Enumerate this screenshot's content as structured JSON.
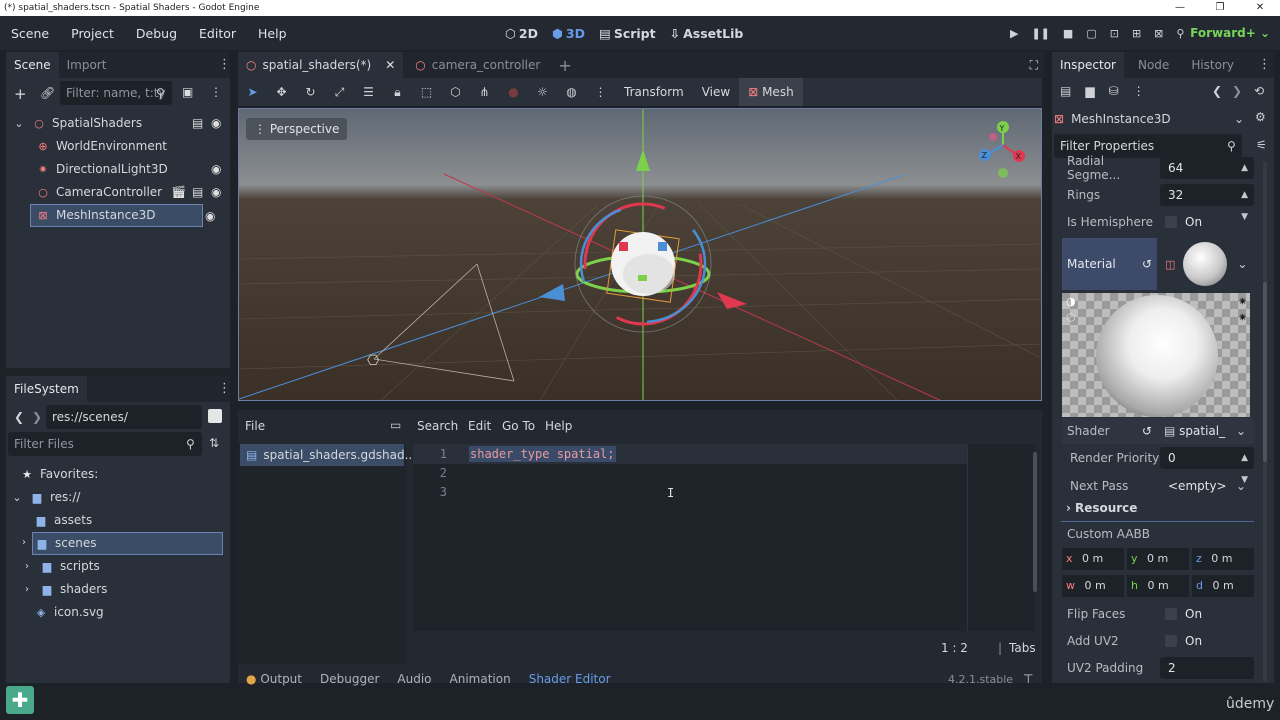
{
  "window": {
    "title": "(*) spatial_shaders.tscn - Spatial Shaders - Godot Engine",
    "controls": [
      "—",
      "❐",
      "✕"
    ]
  },
  "menubar": {
    "items": [
      "Scene",
      "Project",
      "Debug",
      "Editor",
      "Help"
    ],
    "modes": [
      "2D",
      "3D",
      "Script",
      "AssetLib"
    ],
    "renderer": "Forward+"
  },
  "scene_dock": {
    "tabs": [
      "Scene",
      "Import"
    ],
    "filter_placeholder": "Filter: name, t:ty",
    "nodes": [
      "SpatialShaders",
      "WorldEnvironment",
      "DirectionalLight3D",
      "CameraController",
      "MeshInstance3D"
    ]
  },
  "filesystem_dock": {
    "tab": "FileSystem",
    "path": "res://scenes/",
    "filter_placeholder": "Filter Files",
    "items": [
      "Favorites:",
      "res://",
      "assets",
      "scenes",
      "scripts",
      "shaders",
      "icon.svg"
    ]
  },
  "editor_tabs": [
    "spatial_shaders(*)",
    "camera_controller"
  ],
  "viewport_toolbar": {
    "menus": [
      "Transform",
      "View",
      "Mesh"
    ],
    "perspective_label": "Perspective"
  },
  "gizmo_axes": [
    "Y",
    "Z",
    "X"
  ],
  "shader_editor": {
    "menus": [
      "File",
      "Search",
      "Edit",
      "Go To",
      "Help"
    ],
    "file": "spatial_shaders.gdshad...",
    "lines": [
      "shader_type spatial;",
      "",
      ""
    ],
    "line_numbers": [
      "1",
      "2",
      "3"
    ],
    "cursor": "1 :    2",
    "indent": "Tabs"
  },
  "bottom_tabs": [
    "Output",
    "Debugger",
    "Audio",
    "Animation",
    "Shader Editor"
  ],
  "version": "4.2.1.stable",
  "inspector": {
    "tabs": [
      "Inspector",
      "Node",
      "History"
    ],
    "object": "MeshInstance3D",
    "filter_placeholder": "Filter Properties",
    "props": {
      "radial_segments_label": "Radial Segme...",
      "radial_segments": "64",
      "rings_label": "Rings",
      "rings": "32",
      "is_hemisphere_label": "Is Hemisphere",
      "on": "On",
      "material_label": "Material",
      "shader_label": "Shader",
      "shader_value": "spatial_",
      "render_priority_label": "Render Priority",
      "render_priority": "0",
      "next_pass_label": "Next Pass",
      "next_pass": "<empty>",
      "resource_label": "Resource",
      "custom_aabb_label": "Custom AABB",
      "aabb": [
        [
          "x",
          "0 m"
        ],
        [
          "y",
          "0 m"
        ],
        [
          "z",
          "0 m"
        ],
        [
          "w",
          "0 m"
        ],
        [
          "h",
          "0 m"
        ],
        [
          "d",
          "0 m"
        ]
      ],
      "flip_faces_label": "Flip Faces",
      "add_uv2_label": "Add UV2",
      "uv2_padding_label": "UV2 Padding",
      "uv2_padding": "2"
    }
  },
  "watermark": "ûdemy",
  "colors": {
    "accent": "#699ce8",
    "renderer": "#76d55a",
    "selection": "#3b4c66"
  }
}
